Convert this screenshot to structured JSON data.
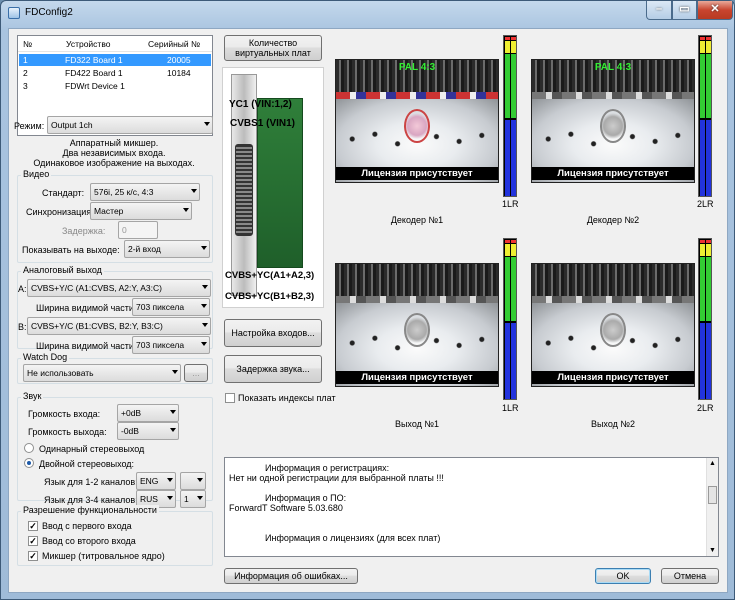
{
  "window": {
    "title": "FDConfig2",
    "min": "–",
    "max": "▭",
    "close": "✕"
  },
  "devices": {
    "headers": [
      "№",
      "Устройство",
      "Серийный №"
    ],
    "rows": [
      {
        "n": "1",
        "name": "FD322 Board 1",
        "serial": "20005"
      },
      {
        "n": "2",
        "name": "FD422 Board 1",
        "serial": "10184"
      },
      {
        "n": "3",
        "name": "FDWrt Device 1",
        "serial": ""
      }
    ]
  },
  "mode": {
    "label": "Режим:",
    "value": "Output 1ch",
    "desc1": "Аппаратный микшер.",
    "desc2": "Два независимых входа.",
    "desc3": "Одинаковое изображение на выходах."
  },
  "video": {
    "title": "Видео",
    "standard_label": "Стандарт:",
    "standard_value": "576i, 25 к/с, 4:3",
    "sync_label": "Синхронизация:",
    "sync_value": "Мастер",
    "delay_label": "Задержка:",
    "delay_value": "0",
    "show_label": "Показывать на выходе:",
    "show_value": "2-й вход"
  },
  "analog": {
    "title": "Аналоговый выход",
    "a_label": "A:",
    "a_value": "CVBS+Y/C (A1:CVBS, A2:Y, A3:C)",
    "width_label": "Ширина видимой части:",
    "a_width": "703 пиксела",
    "b_label": "B:",
    "b_value": "CVBS+Y/C (B1:CVBS, B2:Y, B3:C)",
    "b_width": "703 пиксела"
  },
  "watchdog": {
    "title": "Watch Dog",
    "value": "Не использовать",
    "browse": "..."
  },
  "sound": {
    "title": "Звук",
    "in_label": "Громкость входа:",
    "in_value": "+0dB",
    "out_label": "Громкость выхода:",
    "out_value": "-0dB",
    "single": "Одинарный стереовыход",
    "double": "Двойной стереовыход:",
    "lang12_label": "Язык для 1-2 каналов:",
    "lang12": "ENG",
    "lang12_ch": "",
    "lang34_label": "Язык для 3-4 каналов:",
    "lang34": "RUS",
    "lang34_ch": "1"
  },
  "features": {
    "title": "Разрешение функциональности",
    "f1": "Ввод с первого входа",
    "f2": "Ввод со второго входа",
    "f3": "Микшер (титровальное ядро)"
  },
  "board": {
    "virtual_btn": "Количество виртуальных плат",
    "yc1": "YC1 (VIN:1,2)",
    "cvbs1": "CVBS1 (VIN1)",
    "cvbs_a": "CVBS+YC(A1+A2,3)",
    "cvbs_b": "CVBS+YC(B1+B2,3)",
    "inputs_btn": "Настройка входов...",
    "audio_btn": "Задержка звука...",
    "show_idx": "Показать индексы плат"
  },
  "previews": [
    {
      "caption": "Декодер №1",
      "pal": "PAL 4:3",
      "lic": "Лицензия присутствует",
      "meter": "1LR"
    },
    {
      "caption": "Декодер №2",
      "pal": "PAL 4:3",
      "lic": "Лицензия присутствует",
      "meter": "2LR"
    },
    {
      "caption": "Выход №1",
      "pal": "",
      "lic": "Лицензия присутствует",
      "meter": "1LR"
    },
    {
      "caption": "Выход №2",
      "pal": "",
      "lic": "Лицензия присутствует",
      "meter": "2LR"
    }
  ],
  "info": {
    "reg_title": "Информация о регистрациях:",
    "reg_text": "Нет ни одной регистрации для выбранной платы !!!",
    "sw_title": "Информация о ПО:",
    "sw_text": "ForwardT Software 5.03.680",
    "lic_title": "Информация о лицензиях (для всех плат)"
  },
  "buttons": {
    "errors": "Информация об ошибках...",
    "ok": "OK",
    "cancel": "Отмена"
  }
}
